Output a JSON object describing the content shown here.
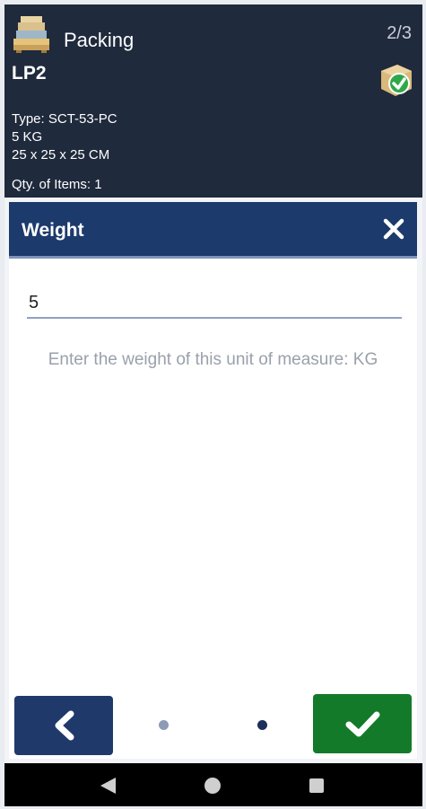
{
  "header": {
    "app_title": "Packing",
    "page_counter": "2/3",
    "lp_title": "LP2",
    "type": "Type: SCT-53-PC",
    "weight": "5 KG",
    "dimensions": "25 x 25 x 25 CM",
    "qty": "Qty. of Items: 1",
    "app_icon": "pallet-boxes-icon",
    "status_icon": "box-check-icon"
  },
  "dialog": {
    "title": "Weight",
    "close_icon": "close-icon",
    "input_value": "5",
    "hint": "Enter the weight of this unit of measure: KG"
  },
  "navigation": {
    "back_icon": "chevron-left-icon",
    "confirm_icon": "checkmark-icon",
    "pager_dots": 2,
    "active_dot": 2
  },
  "colors": {
    "header_bg": "#1f2a3c",
    "dialog_bar": "#1c3a6b",
    "back_button": "#1f3a6a",
    "confirm_button": "#137a2a",
    "hint_text": "#9aa1ab"
  }
}
